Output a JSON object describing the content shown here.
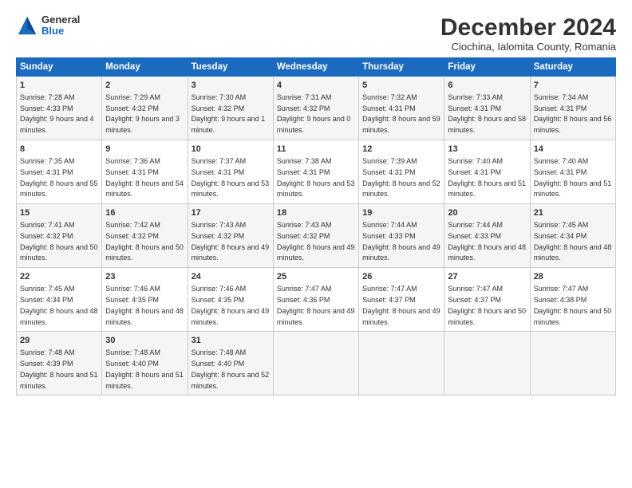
{
  "logo": {
    "general": "General",
    "blue": "Blue"
  },
  "title": "December 2024",
  "subtitle": "Ciochina, Ialomita County, Romania",
  "headers": [
    "Sunday",
    "Monday",
    "Tuesday",
    "Wednesday",
    "Thursday",
    "Friday",
    "Saturday"
  ],
  "weeks": [
    [
      {
        "day": "1",
        "sunrise": "7:28 AM",
        "sunset": "4:33 PM",
        "daylight": "9 hours and 4 minutes."
      },
      {
        "day": "2",
        "sunrise": "7:29 AM",
        "sunset": "4:32 PM",
        "daylight": "9 hours and 3 minutes."
      },
      {
        "day": "3",
        "sunrise": "7:30 AM",
        "sunset": "4:32 PM",
        "daylight": "9 hours and 1 minute."
      },
      {
        "day": "4",
        "sunrise": "7:31 AM",
        "sunset": "4:32 PM",
        "daylight": "9 hours and 0 minutes."
      },
      {
        "day": "5",
        "sunrise": "7:32 AM",
        "sunset": "4:31 PM",
        "daylight": "8 hours and 59 minutes."
      },
      {
        "day": "6",
        "sunrise": "7:33 AM",
        "sunset": "4:31 PM",
        "daylight": "8 hours and 58 minutes."
      },
      {
        "day": "7",
        "sunrise": "7:34 AM",
        "sunset": "4:31 PM",
        "daylight": "8 hours and 56 minutes."
      }
    ],
    [
      {
        "day": "8",
        "sunrise": "7:35 AM",
        "sunset": "4:31 PM",
        "daylight": "8 hours and 55 minutes."
      },
      {
        "day": "9",
        "sunrise": "7:36 AM",
        "sunset": "4:31 PM",
        "daylight": "8 hours and 54 minutes."
      },
      {
        "day": "10",
        "sunrise": "7:37 AM",
        "sunset": "4:31 PM",
        "daylight": "8 hours and 53 minutes."
      },
      {
        "day": "11",
        "sunrise": "7:38 AM",
        "sunset": "4:31 PM",
        "daylight": "8 hours and 53 minutes."
      },
      {
        "day": "12",
        "sunrise": "7:39 AM",
        "sunset": "4:31 PM",
        "daylight": "8 hours and 52 minutes."
      },
      {
        "day": "13",
        "sunrise": "7:40 AM",
        "sunset": "4:31 PM",
        "daylight": "8 hours and 51 minutes."
      },
      {
        "day": "14",
        "sunrise": "7:40 AM",
        "sunset": "4:31 PM",
        "daylight": "8 hours and 51 minutes."
      }
    ],
    [
      {
        "day": "15",
        "sunrise": "7:41 AM",
        "sunset": "4:32 PM",
        "daylight": "8 hours and 50 minutes."
      },
      {
        "day": "16",
        "sunrise": "7:42 AM",
        "sunset": "4:32 PM",
        "daylight": "8 hours and 50 minutes."
      },
      {
        "day": "17",
        "sunrise": "7:43 AM",
        "sunset": "4:32 PM",
        "daylight": "8 hours and 49 minutes."
      },
      {
        "day": "18",
        "sunrise": "7:43 AM",
        "sunset": "4:32 PM",
        "daylight": "8 hours and 49 minutes."
      },
      {
        "day": "19",
        "sunrise": "7:44 AM",
        "sunset": "4:33 PM",
        "daylight": "8 hours and 49 minutes."
      },
      {
        "day": "20",
        "sunrise": "7:44 AM",
        "sunset": "4:33 PM",
        "daylight": "8 hours and 48 minutes."
      },
      {
        "day": "21",
        "sunrise": "7:45 AM",
        "sunset": "4:34 PM",
        "daylight": "8 hours and 48 minutes."
      }
    ],
    [
      {
        "day": "22",
        "sunrise": "7:45 AM",
        "sunset": "4:34 PM",
        "daylight": "8 hours and 48 minutes."
      },
      {
        "day": "23",
        "sunrise": "7:46 AM",
        "sunset": "4:35 PM",
        "daylight": "8 hours and 48 minutes."
      },
      {
        "day": "24",
        "sunrise": "7:46 AM",
        "sunset": "4:35 PM",
        "daylight": "8 hours and 49 minutes."
      },
      {
        "day": "25",
        "sunrise": "7:47 AM",
        "sunset": "4:36 PM",
        "daylight": "8 hours and 49 minutes."
      },
      {
        "day": "26",
        "sunrise": "7:47 AM",
        "sunset": "4:37 PM",
        "daylight": "8 hours and 49 minutes."
      },
      {
        "day": "27",
        "sunrise": "7:47 AM",
        "sunset": "4:37 PM",
        "daylight": "8 hours and 50 minutes."
      },
      {
        "day": "28",
        "sunrise": "7:47 AM",
        "sunset": "4:38 PM",
        "daylight": "8 hours and 50 minutes."
      }
    ],
    [
      {
        "day": "29",
        "sunrise": "7:48 AM",
        "sunset": "4:39 PM",
        "daylight": "8 hours and 51 minutes."
      },
      {
        "day": "30",
        "sunrise": "7:48 AM",
        "sunset": "4:40 PM",
        "daylight": "8 hours and 51 minutes."
      },
      {
        "day": "31",
        "sunrise": "7:48 AM",
        "sunset": "4:40 PM",
        "daylight": "8 hours and 52 minutes."
      },
      null,
      null,
      null,
      null
    ]
  ]
}
